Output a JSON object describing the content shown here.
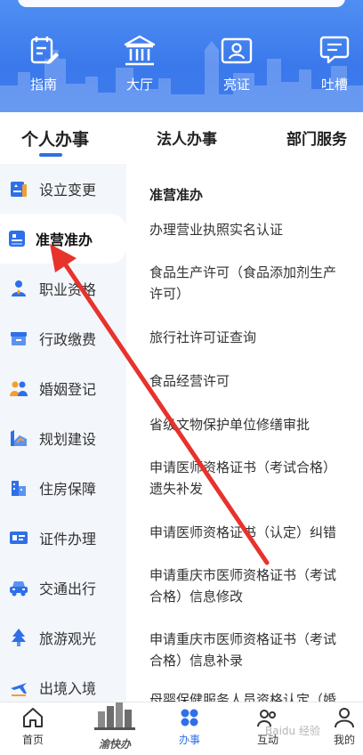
{
  "quick_nav": [
    {
      "label": "指南",
      "icon": "guide-icon"
    },
    {
      "label": "大厅",
      "icon": "hall-icon"
    },
    {
      "label": "亮证",
      "icon": "id-card-icon"
    },
    {
      "label": "吐槽",
      "icon": "feedback-icon"
    }
  ],
  "tabs": [
    {
      "label": "个人办事",
      "active": true
    },
    {
      "label": "法人办事",
      "active": false
    },
    {
      "label": "部门服务",
      "active": false
    }
  ],
  "categories": [
    {
      "label": "设立变更",
      "icon": "register-icon"
    },
    {
      "label": "准营准办",
      "icon": "license-icon",
      "active": true
    },
    {
      "label": "职业资格",
      "icon": "qualification-icon"
    },
    {
      "label": "行政缴费",
      "icon": "payment-icon"
    },
    {
      "label": "婚姻登记",
      "icon": "marriage-icon"
    },
    {
      "label": "规划建设",
      "icon": "planning-icon"
    },
    {
      "label": "住房保障",
      "icon": "housing-icon"
    },
    {
      "label": "证件办理",
      "icon": "certificate-icon"
    },
    {
      "label": "交通出行",
      "icon": "car-icon"
    },
    {
      "label": "旅游观光",
      "icon": "tree-icon"
    },
    {
      "label": "出境入境",
      "icon": "plane-icon"
    }
  ],
  "content": {
    "section_title": "准营准办",
    "items": [
      [
        "办理营业执照实名认证"
      ],
      [
        "食品生产许可（食品添加剂生产",
        "许可）"
      ],
      [
        "旅行社许可证查询"
      ],
      [
        "食品经营许可"
      ],
      [
        "省级文物保护单位修缮审批"
      ],
      [
        "申请医师资格证书（考试合格）",
        "遗失补发"
      ],
      [
        "申请医师资格证书（认定）纠错"
      ],
      [
        "申请重庆市医师资格证书（考试",
        "合格）信息修改"
      ],
      [
        "申请重庆市医师资格证书（考试",
        "合格）信息补录"
      ],
      [
        "母婴保健服务人员资格认定（婚"
      ]
    ]
  },
  "bottom_nav": [
    {
      "label": "首页",
      "icon": "home-icon"
    },
    {
      "label": "渝快办",
      "icon": "yukuaiban-logo"
    },
    {
      "label": "办事",
      "icon": "services-icon",
      "active": true
    },
    {
      "label": "互动",
      "icon": "interact-icon"
    },
    {
      "label": "我的",
      "icon": "profile-icon"
    }
  ],
  "watermark": "Baidu 经验",
  "colors": {
    "primary": "#2f6fe8",
    "header": "#3e7dee",
    "arrow": "#e8322c",
    "sidebar_bg": "#f3f6fb"
  }
}
